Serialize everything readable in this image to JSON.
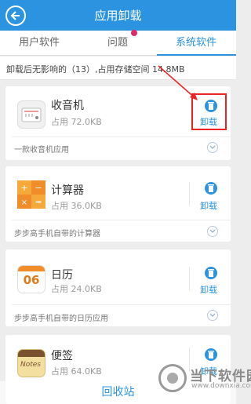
{
  "header": {
    "title": "应用卸载"
  },
  "tabs": [
    {
      "label": "用户软件"
    },
    {
      "label": "问题"
    },
    {
      "label": "系统软件"
    }
  ],
  "info": {
    "text": "卸载后无影响的（13）,占用存储空间 14.8MB"
  },
  "apps": [
    {
      "name": "收音机",
      "size": "占用 72.0KB",
      "action": "卸载",
      "description": "一款收音机应用",
      "icon": "radio-icon"
    },
    {
      "name": "计算器",
      "size": "占用 36.0KB",
      "action": "卸载",
      "description": "步步高手机自带的计算器",
      "icon": "calculator-icon"
    },
    {
      "name": "日历",
      "size": "占用 24.0KB",
      "action": "卸载",
      "description": "步步高手机自带的日历应用",
      "icon": "calendar-icon",
      "calendar_day": "06"
    },
    {
      "name": "便签",
      "size": "占用 64.0KB",
      "action": "卸载",
      "icon": "notes-icon",
      "icon_label": "Notes"
    }
  ],
  "footer": {
    "recycle": "回收站"
  },
  "watermark": {
    "text": "当下软件园",
    "url": "www.downxia.com"
  },
  "colors": {
    "accent": "#2b93e0",
    "highlight": "#e22222",
    "notification": "#e02b6a"
  }
}
